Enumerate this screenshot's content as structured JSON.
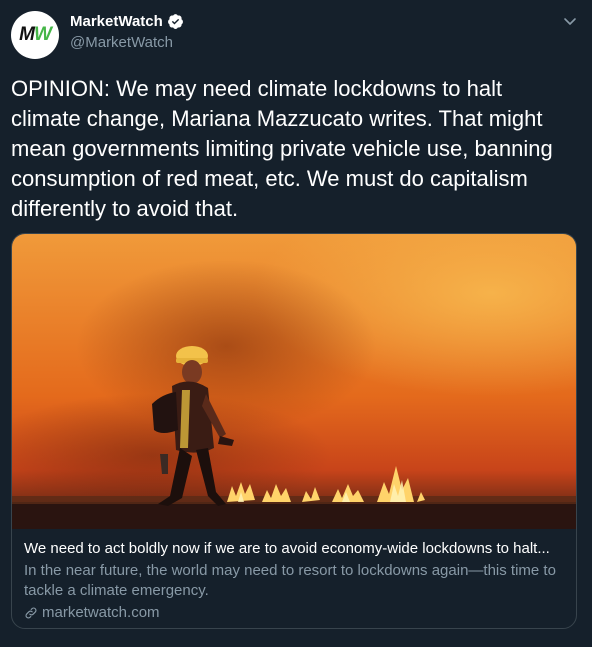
{
  "author": {
    "display_name": "MarketWatch",
    "handle": "@MarketWatch",
    "avatar_text_m": "M",
    "avatar_text_w": "W",
    "verified": true
  },
  "tweet": {
    "text": "OPINION: We may need climate lockdowns to halt climate change, Mariana Mazzucato writes. That might mean governments limiting private vehicle use, banning consumption of red meat, etc. We must do capitalism differently to avoid that."
  },
  "card": {
    "title": "We need to act boldly now if we are to avoid economy-wide lockdowns to halt...",
    "description": "In the near future, the world may need to resort to lockdowns again—this time to tackle a climate emergency.",
    "domain": "marketwatch.com",
    "image_icon": "firefighter-wildfire-photo"
  },
  "icons": {
    "verified": "verified-badge-icon",
    "caret": "chevron-down-icon",
    "link": "link-icon"
  },
  "colors": {
    "background": "#15202b",
    "text_primary": "#ffffff",
    "text_secondary": "#8899a6",
    "border": "#38444d",
    "verified": "#ffffff",
    "brand_green": "#46b648"
  }
}
